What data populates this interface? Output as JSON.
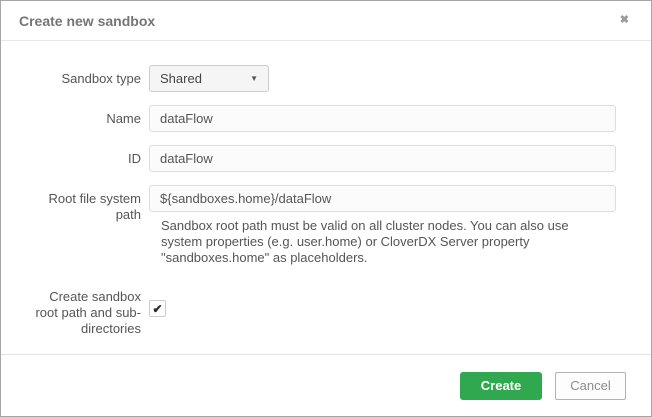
{
  "dialog": {
    "title": "Create new sandbox"
  },
  "icons": {
    "close": "✖",
    "dropdown_caret": "▼",
    "checkmark": "✔"
  },
  "form": {
    "sandbox_type": {
      "label": "Sandbox type",
      "value": "Shared"
    },
    "name": {
      "label": "Name",
      "value": "dataFlow"
    },
    "id": {
      "label": "ID",
      "value": "dataFlow"
    },
    "root_path": {
      "label": "Root file system path",
      "value": "${sandboxes.home}/dataFlow",
      "help": "Sandbox root path must be valid on all cluster nodes. You can also use system properties (e.g. user.home) or CloverDX Server property \"sandboxes.home\" as placeholders."
    },
    "create_root": {
      "label": "Create sandbox root path and sub-directories",
      "checked": "checked"
    }
  },
  "footer": {
    "create_label": "Create",
    "cancel_label": "Cancel"
  },
  "colors": {
    "create_button_green": "#2fa84f",
    "label_text": "#555555",
    "title_text": "#757575",
    "input_border": "#dddddd",
    "input_background": "#fbfbfb",
    "dialog_border": "#a6a6a6"
  }
}
